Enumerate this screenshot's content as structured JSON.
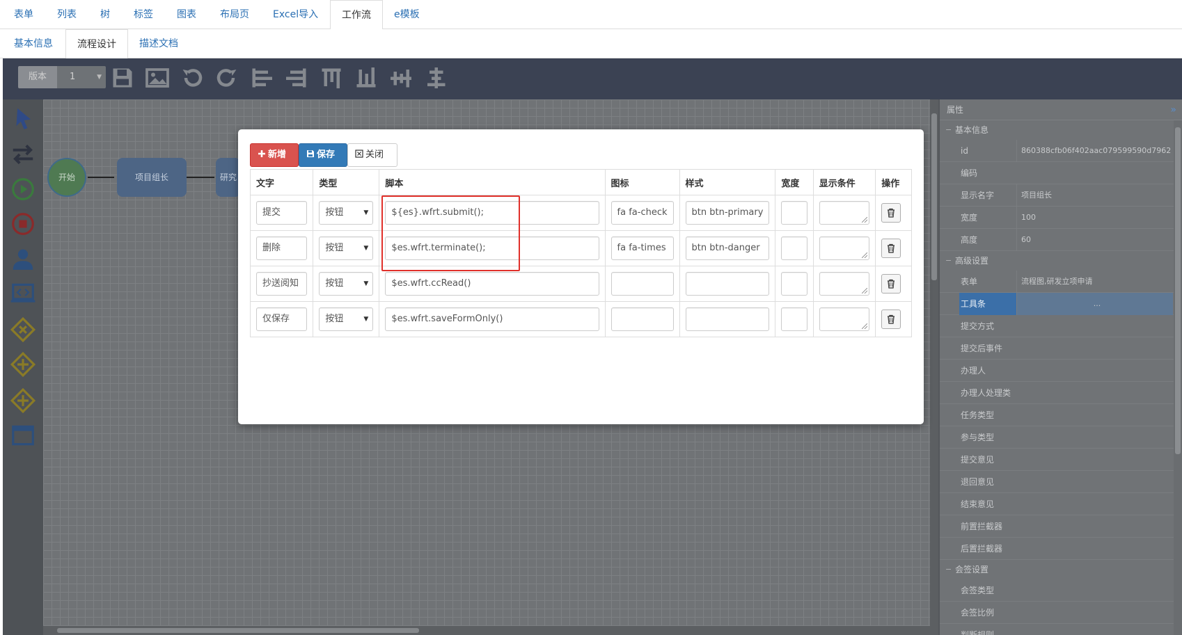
{
  "tabs_top": [
    {
      "label": "表单"
    },
    {
      "label": "列表"
    },
    {
      "label": "树"
    },
    {
      "label": "标签"
    },
    {
      "label": "图表"
    },
    {
      "label": "布局页"
    },
    {
      "label": "Excel导入"
    },
    {
      "label": "工作流",
      "active": true
    },
    {
      "label": "e模板"
    }
  ],
  "tabs_sub": [
    {
      "label": "基本信息"
    },
    {
      "label": "流程设计",
      "active": true
    },
    {
      "label": "描述文档"
    }
  ],
  "toolbar": {
    "version_label": "版本",
    "version_value": "1",
    "icons": [
      "save-icon",
      "image-icon",
      "undo-icon",
      "redo-icon",
      "align-left-icon",
      "align-right-icon",
      "align-top-icon",
      "align-bottom-icon",
      "align-middle-icon",
      "align-center-icon"
    ]
  },
  "palette": [
    "pointer-icon",
    "transition-icon",
    "start-event-icon",
    "end-event-icon",
    "user-task-icon",
    "script-task-icon",
    "exclusive-gateway-icon",
    "parallel-gateway-icon",
    "inclusive-gateway-icon",
    "subprocess-icon"
  ],
  "flow": {
    "start_label": "开始",
    "task1_label": "项目组长",
    "task2_label": "研究"
  },
  "properties": {
    "title": "属性",
    "sections": [
      {
        "name": "基本信息",
        "rows": [
          {
            "key": "id",
            "value": "860388cfb06f402aac079599590d7962"
          },
          {
            "key": "编码",
            "value": ""
          },
          {
            "key": "显示名字",
            "value": "项目组长"
          },
          {
            "key": "宽度",
            "value": "100"
          },
          {
            "key": "高度",
            "value": "60"
          }
        ]
      },
      {
        "name": "高级设置",
        "rows": [
          {
            "key": "表单",
            "value": "流程图,研发立项申请"
          },
          {
            "key": "工具条",
            "value": "...",
            "selected": true
          },
          {
            "key": "提交方式",
            "value": ""
          },
          {
            "key": "提交后事件",
            "value": ""
          },
          {
            "key": "办理人",
            "value": ""
          },
          {
            "key": "办理人处理类",
            "value": ""
          },
          {
            "key": "任务类型",
            "value": ""
          },
          {
            "key": "参与类型",
            "value": ""
          },
          {
            "key": "提交意见",
            "value": ""
          },
          {
            "key": "退回意见",
            "value": ""
          },
          {
            "key": "结束意见",
            "value": ""
          },
          {
            "key": "前置拦截器",
            "value": ""
          },
          {
            "key": "后置拦截器",
            "value": ""
          }
        ]
      },
      {
        "name": "会签设置",
        "rows": [
          {
            "key": "会签类型",
            "value": ""
          },
          {
            "key": "会签比例",
            "value": ""
          },
          {
            "key": "判断规则",
            "value": ""
          }
        ]
      }
    ]
  },
  "modal": {
    "add_label": "新增",
    "save_label": "保存",
    "close_label": "关闭",
    "columns": [
      "文字",
      "类型",
      "脚本",
      "图标",
      "样式",
      "宽度",
      "显示条件",
      "操作"
    ],
    "rows": [
      {
        "text": "提交",
        "type": "按钮",
        "script": "${es}.wfrt.submit();",
        "icon": "fa fa-check",
        "style": "btn btn-primary",
        "width": "",
        "condition": ""
      },
      {
        "text": "删除",
        "type": "按钮",
        "script": "$es.wfrt.terminate();",
        "icon": "fa fa-times",
        "style": "btn btn-danger",
        "width": "",
        "condition": ""
      },
      {
        "text": "抄送阅知",
        "type": "按钮",
        "script": "$es.wfrt.ccRead()",
        "icon": "",
        "style": "",
        "width": "",
        "condition": ""
      },
      {
        "text": "仅保存",
        "type": "按钮",
        "script": "$es.wfrt.saveFormOnly()",
        "icon": "",
        "style": "",
        "width": "",
        "condition": ""
      }
    ]
  },
  "colors": {
    "accent_red": "#d9534f",
    "accent_blue": "#337ab7",
    "highlight_box": "#e0302a"
  }
}
